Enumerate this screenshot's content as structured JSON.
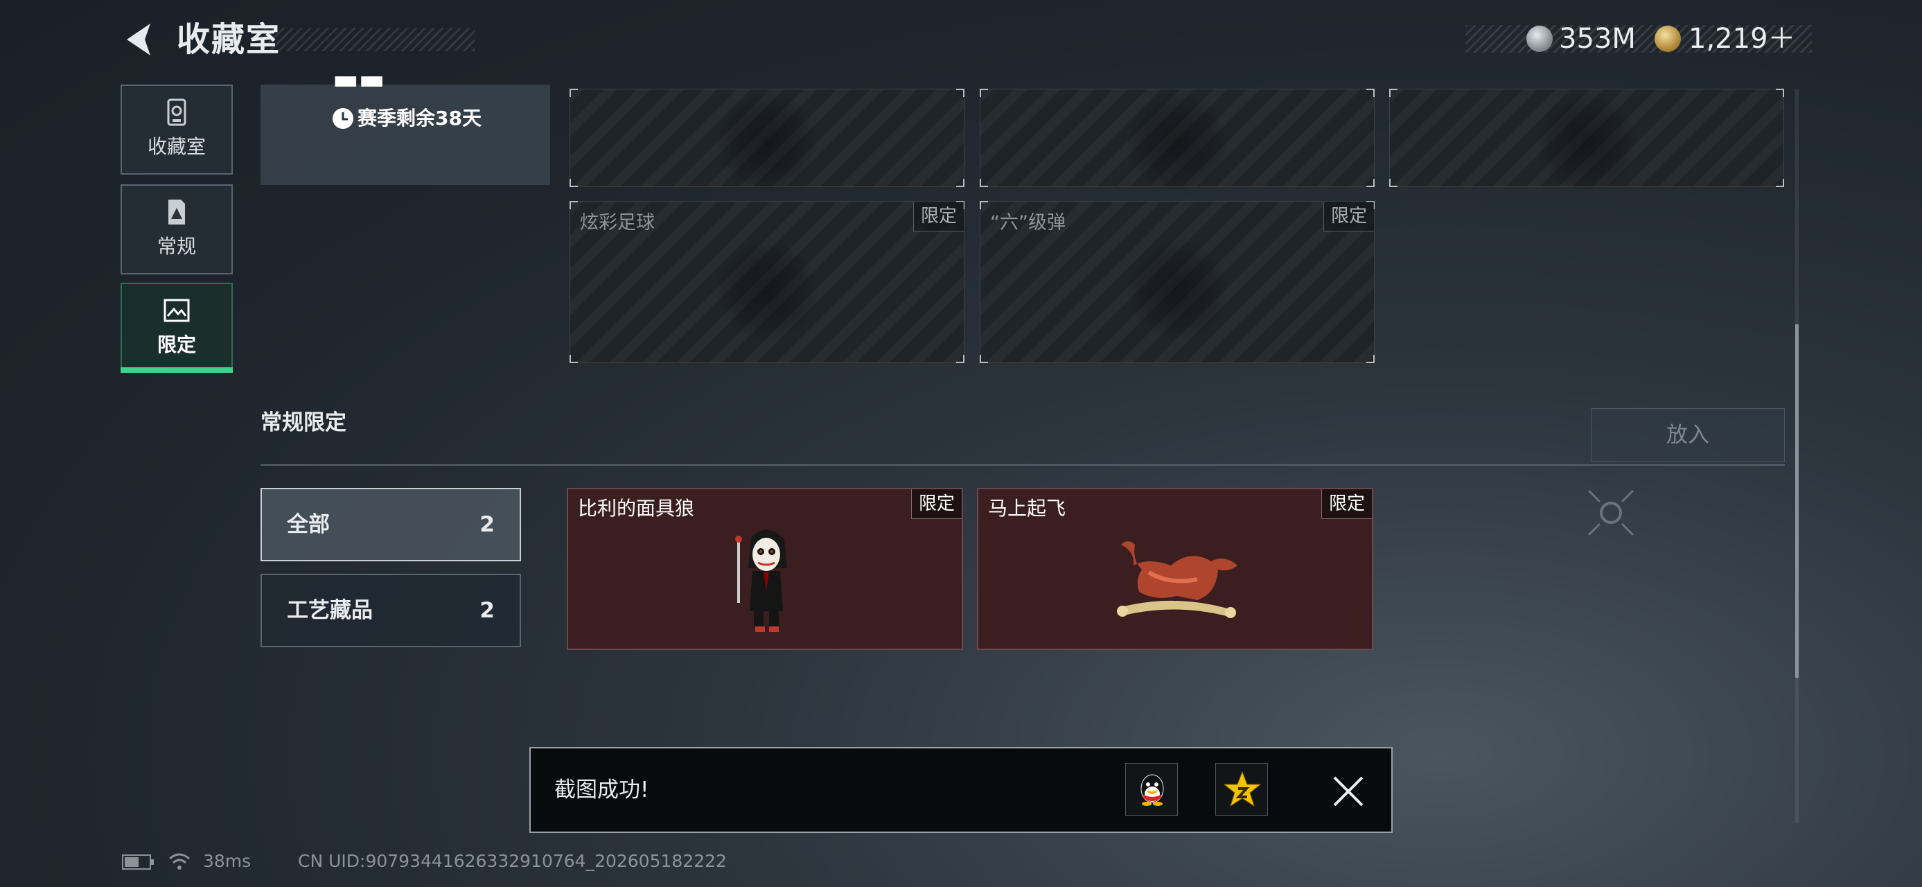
{
  "header": {
    "title": "收藏室"
  },
  "currency": [
    {
      "value": "353M",
      "icon": "silver-coin-icon",
      "color": "#aeb5ba"
    },
    {
      "value": "1,219＋",
      "icon": "gold-coin-icon",
      "color": "#c9a14a"
    }
  ],
  "nav": [
    {
      "label": "收藏室",
      "icon": "vault-icon"
    },
    {
      "label": "常规",
      "icon": "document-warning-icon"
    },
    {
      "label": "限定",
      "icon": "picture-icon",
      "selected": true
    }
  ],
  "season": {
    "remaining": "赛季剩余38天"
  },
  "locked_slots": [
    {
      "name": ""
    },
    {
      "name": ""
    },
    {
      "name": ""
    },
    {
      "name": "炫彩足球",
      "tag": "限定"
    },
    {
      "name": "“六”级弹",
      "tag": "限定"
    }
  ],
  "regular": {
    "title": "常规限定",
    "place_button": "放入",
    "categories": [
      {
        "label": "全部",
        "count": "2",
        "selected": true
      },
      {
        "label": "工艺藏品",
        "count": "2"
      }
    ],
    "items": [
      {
        "name": "比利的面具狼",
        "tag": "限定"
      },
      {
        "name": "马上起飞",
        "tag": "限定"
      }
    ]
  },
  "toast": {
    "message": "截图成功!",
    "qq_icon": "qq-icon",
    "qzone_icon": "qzone-icon",
    "close_icon": "close-icon"
  },
  "status": {
    "ping": "38ms",
    "uid": "CN UID:907934416263329107­64_202605182222"
  },
  "colors": {
    "accent_green": "#3ed38d",
    "item_bg": "#3b1e20"
  }
}
